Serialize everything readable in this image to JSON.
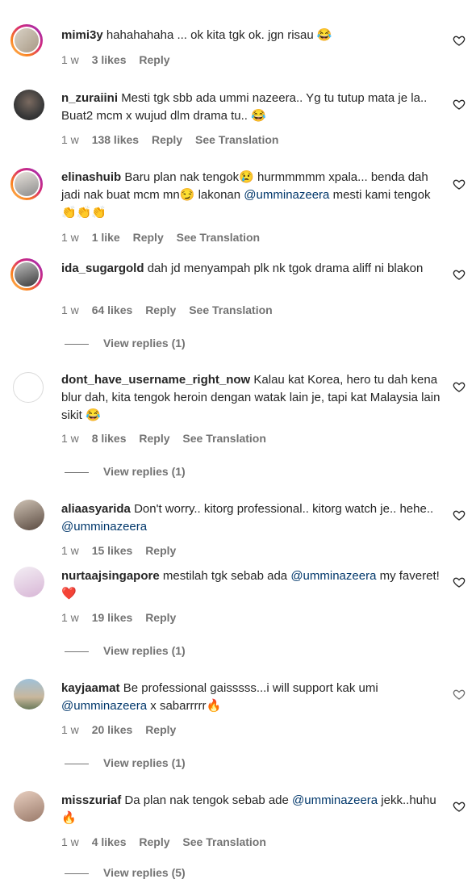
{
  "comments": [
    {
      "user": "mimi3y",
      "text": "hahahahaha ... ok kita tgk ok. jgn risau 😂",
      "time": "1 w",
      "likes": "3 likes",
      "reply": "Reply",
      "translation": ""
    },
    {
      "user": "n_zuraiini",
      "text": "Mesti tgk sbb ada ummi nazeera.. Yg tu tutup mata je la.. Buat2 mcm x wujud dlm drama tu.. 😂",
      "time": "1 w",
      "likes": "138 likes",
      "reply": "Reply",
      "translation": "See Translation"
    },
    {
      "user": "elinashuib",
      "text_pre": "Baru plan nak tengok😢 hurmmmmm xpala... benda dah jadi nak buat mcm mn😏 lakonan ",
      "mention": "@umminazeera",
      "text_post": " mesti kami tengok👏👏👏",
      "time": "1 w",
      "likes": "1 like",
      "reply": "Reply",
      "translation": "See Translation"
    },
    {
      "user": "ida_sugargold",
      "text": "dah jd menyampah plk nk tgok drama aliff ni blakon",
      "time": "1 w",
      "likes": "64 likes",
      "reply": "Reply",
      "translation": "See Translation",
      "view_replies": "View replies (1)"
    },
    {
      "user": "dont_have_username_right_now",
      "text": "Kalau kat Korea, hero tu dah kena blur dah, kita tengok heroin dengan watak lain je, tapi kat Malaysia lain sikit 😂",
      "time": "1 w",
      "likes": "8 likes",
      "reply": "Reply",
      "translation": "See Translation",
      "view_replies": "View replies (1)"
    },
    {
      "user": "aliaasyarida",
      "text_pre": "Don't worry.. kitorg professional.. kitorg watch je.. hehe.. ",
      "mention": "@umminazeera",
      "text_post": "",
      "time": "1 w",
      "likes": "15 likes",
      "reply": "Reply",
      "translation": ""
    },
    {
      "user": "nurtaajsingapore",
      "text_pre": "mestilah tgk sebab ada ",
      "mention": "@umminazeera",
      "text_post": " my faveret!❤️",
      "time": "1 w",
      "likes": "19 likes",
      "reply": "Reply",
      "translation": "",
      "view_replies": "View replies (1)"
    },
    {
      "user": "kayjaamat",
      "text_pre": "Be professional gaisssss...i will support kak umi ",
      "mention": "@umminazeera",
      "text_post": " x sabarrrrr🔥",
      "time": "1 w",
      "likes": "20 likes",
      "reply": "Reply",
      "translation": "",
      "view_replies": "View replies (1)"
    },
    {
      "user": "misszuriaf",
      "text_pre": "Da plan nak tengok sebab ade ",
      "mention": "@umminazeera",
      "text_post": " jekk..huhu🔥",
      "time": "1 w",
      "likes": "4 likes",
      "reply": "Reply",
      "translation": "See Translation",
      "view_replies": "View replies (5)"
    }
  ],
  "colors": {
    "link": "#00376b",
    "meta": "#737373",
    "text": "#262626"
  }
}
